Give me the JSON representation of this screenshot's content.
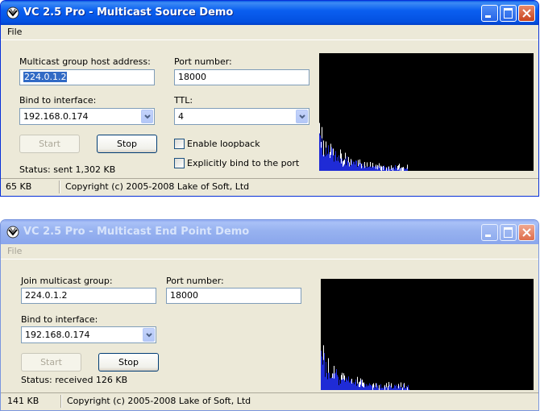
{
  "source_window": {
    "title": "VC 2.5 Pro - Multicast Source Demo",
    "menu": [
      "File"
    ],
    "host_label": "Multicast group host address:",
    "host_value": "224.0.1.2",
    "port_label": "Port number:",
    "port_value": "18000",
    "bind_label": "Bind to interface:",
    "bind_value": "192.168.0.174",
    "ttl_label": "TTL:",
    "ttl_value": "4",
    "start_label": "Start",
    "stop_label": "Stop",
    "loopback_label": "Enable loopback",
    "explicit_bind_label": "Explicitly bind to the port",
    "status_text": "Status: sent 1,302 KB",
    "statusbar_left": "65 KB",
    "statusbar_right": "Copyright (c) 2005-2008 Lake of Soft, Ltd"
  },
  "endpoint_window": {
    "title": "VC 2.5 Pro - Multicast End Point Demo",
    "menu": [
      "File"
    ],
    "join_label": "Join multicast group:",
    "join_value": "224.0.1.2",
    "port_label": "Port number:",
    "port_value": "18000",
    "bind_label": "Bind to interface:",
    "bind_value": "192.168.0.174",
    "start_label": "Start",
    "stop_label": "Stop",
    "status_text": "Status: received 126 KB",
    "statusbar_left": "141 KB",
    "statusbar_right": "Copyright (c) 2005-2008 Lake of Soft, Ltd"
  },
  "colors": {
    "spectrum_bg": "#000000",
    "spectrum_blue": "#1f2bd6",
    "spectrum_white": "#ffffff"
  }
}
